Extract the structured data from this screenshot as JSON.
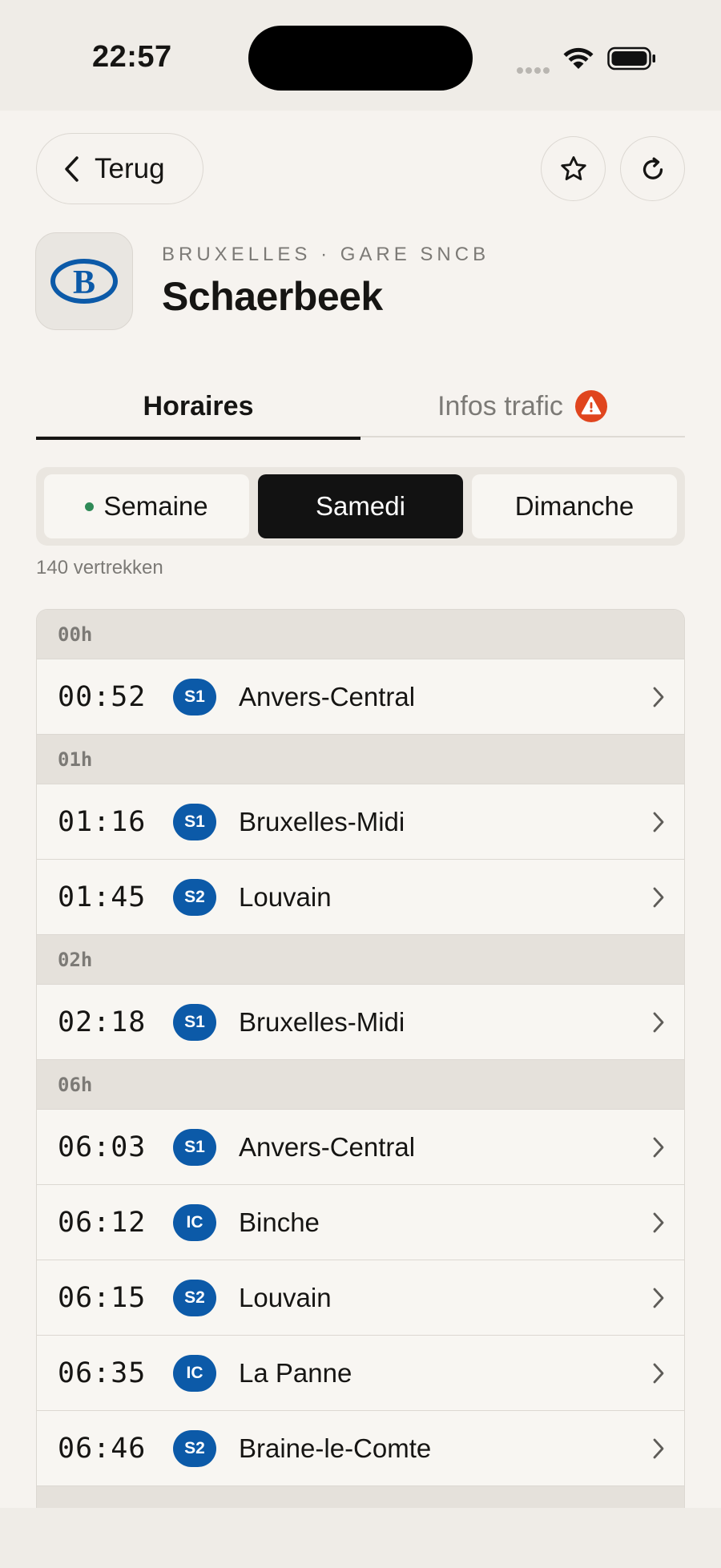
{
  "status": {
    "time": "22:57"
  },
  "header": {
    "back_label": "Terug",
    "star_icon": "star-icon",
    "refresh_icon": "refresh-icon"
  },
  "station": {
    "kicker": "BRUXELLES · GARE SNCB",
    "name": "Schaerbeek",
    "logo_letter": "B"
  },
  "tabs": [
    {
      "label": "Horaires",
      "active": true
    },
    {
      "label": "Infos trafic",
      "active": false,
      "icon": "alert-icon"
    }
  ],
  "day_filter": [
    {
      "label": "Semaine",
      "today": true
    },
    {
      "label": "Samedi",
      "selected": true
    },
    {
      "label": "Dimanche"
    }
  ],
  "count_text": "140 vertrekken",
  "groups": [
    {
      "hour": "00h",
      "departures": [
        {
          "time": "00:52",
          "line": "S1",
          "dest": "Anvers-Central"
        }
      ]
    },
    {
      "hour": "01h",
      "departures": [
        {
          "time": "01:16",
          "line": "S1",
          "dest": "Bruxelles-Midi"
        },
        {
          "time": "01:45",
          "line": "S2",
          "dest": "Louvain"
        }
      ]
    },
    {
      "hour": "02h",
      "departures": [
        {
          "time": "02:18",
          "line": "S1",
          "dest": "Bruxelles-Midi"
        }
      ]
    },
    {
      "hour": "06h",
      "departures": [
        {
          "time": "06:03",
          "line": "S1",
          "dest": "Anvers-Central"
        },
        {
          "time": "06:12",
          "line": "IC",
          "dest": "Binche"
        },
        {
          "time": "06:15",
          "line": "S2",
          "dest": "Louvain"
        },
        {
          "time": "06:35",
          "line": "IC",
          "dest": "La Panne"
        },
        {
          "time": "06:46",
          "line": "S2",
          "dest": "Braine-le-Comte"
        }
      ]
    }
  ],
  "colors": {
    "accent": "#0c5aa8",
    "alert": "#e0451e",
    "today_dot": "#2f8a57",
    "selected_segment": "#121212"
  }
}
